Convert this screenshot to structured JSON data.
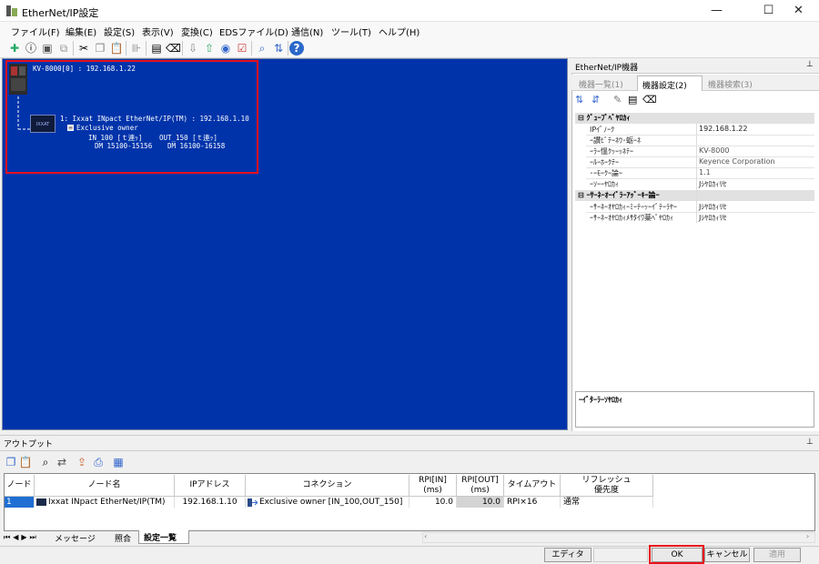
{
  "window": {
    "title": "EtherNet/IP設定",
    "minimize_icon": "minimize-icon",
    "maximize_icon": "maximize-icon",
    "close_icon": "close-icon"
  },
  "menu": [
    "ファイル(F)",
    "編集(E)",
    "設定(S)",
    "表示(V)",
    "変換(C)",
    "EDSファイル(D)",
    "通信(N)",
    "ツール(T)",
    "ヘルプ(H)"
  ],
  "canvas": {
    "plc_label": "KV-8000[0] : 192.168.1.22",
    "device_label": "1: Ixxat INpact EtherNet/IP(TM) : 192.168.1.10",
    "connection_label": "Exclusive owner",
    "in_label": "IN_100 [ｔ連ｯ]",
    "out_label": "OUT_150 [ｔ連ｯ]",
    "in_dm": "DM 15100-15156",
    "out_dm": "DM 16100-16158",
    "device_logo_text": "IXXAT"
  },
  "right_panel": {
    "title": "EtherNet/IP機器",
    "pin_icon": "pin-icon",
    "tabs": [
      "機器一覧(1)",
      "機器設定(2)",
      "機器検索(3)"
    ],
    "active_tab": "機器設定(2)",
    "categories": [
      {
        "name": "ｸﾞｭｰﾌﾟﾍﾟﾔﾛｶｨ",
        "rows": [
          {
            "label": "IPｲﾞﾉｰｸ",
            "value": "192.168.1.22"
          },
          {
            "label": "ｰ讃ﾋﾞﾃｰﾈｳ･蛎ｰﾈ",
            "value": ""
          },
          {
            "label": "ｰﾗｰ慍ｸｯｰｯﾈﾃｰ",
            "value": "KV-8000"
          },
          {
            "label": "ｰﾙｰﾎｰｸﾃｰ",
            "value": "Keyence Corporation"
          },
          {
            "label": "･ｰﾓｰｸｰ論ｰ",
            "value": "1.1"
          },
          {
            "label": "ｰｿｰｰﾔﾛｶｨ",
            "value": "Jｼﾔﾛｶｨﾘｾ"
          }
        ]
      },
      {
        "name": "ｰｻｰﾈｰｵｰｲﾞﾗｰｱｯﾞｰｷｰ論ｰ",
        "rows": [
          {
            "label": "ｰｻｰﾈｰｵﾔﾛｶｨｰﾐｰﾃｰｯｰｲﾞﾃｰﾗﾔｰ",
            "value": "Jｼﾔﾛｶｨﾘｾ"
          },
          {
            "label": "ｰｻｰﾈｰｵﾔﾛｶｨﾒｻﾀｲﾜ薬ﾍﾟﾔﾛｶｨ",
            "value": "Jｼﾔﾛｶｨﾘｾ"
          }
        ]
      }
    ],
    "description_title": "ｰｲﾞﾀｰﾗｰｿﾔﾛｶｨ"
  },
  "output": {
    "title": "アウトプット",
    "columns": [
      "ノード",
      "ノード名",
      "IPアドレス",
      "コネクション",
      "RPI[IN]\n(ms)",
      "RPI[OUT]\n(ms)",
      "タイムアウト",
      "リフレッシュ\n優先度"
    ],
    "rows": [
      {
        "node": "1",
        "node_name": "Ixxat INpact EtherNet/IP(TM)",
        "ip": "192.168.1.10",
        "connection": "Exclusive owner [IN_100,OUT_150]",
        "rpi_in": "10.0",
        "rpi_out": "10.0",
        "timeout": "RPI×16",
        "priority": "通常"
      }
    ],
    "sheet_tabs": [
      "メッセージ",
      "照合",
      "設定一覧"
    ],
    "active_sheet": "設定一覧"
  },
  "status": {
    "editor_label": "エディタ",
    "ok_label": "OK",
    "cancel_label": "キャンセル",
    "apply_label": "適用"
  },
  "colors": {
    "canvas_bg": "#0033aa",
    "highlight": "#e8111b"
  }
}
